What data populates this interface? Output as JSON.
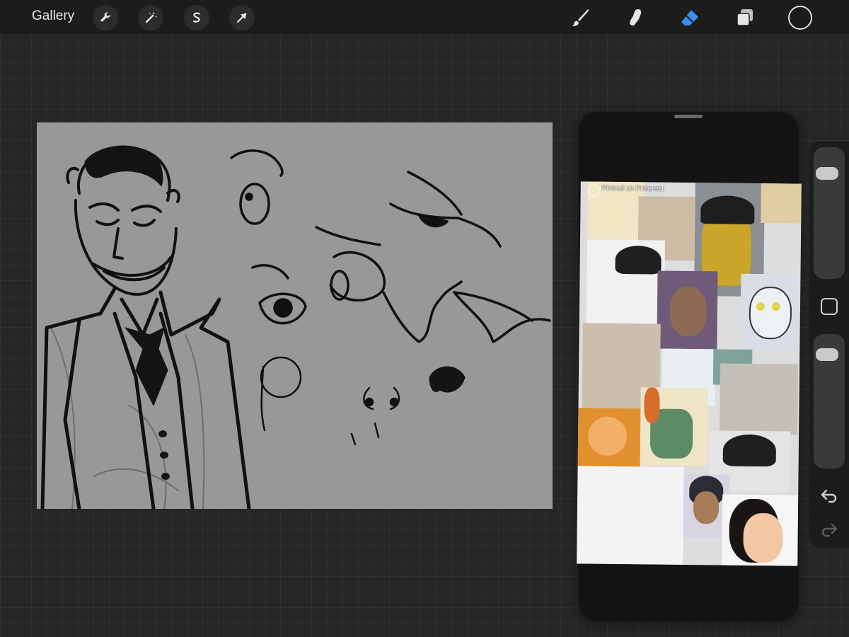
{
  "app": {
    "gallery_label": "Gallery"
  },
  "toolbar": {
    "left_tools": [
      {
        "name": "actions",
        "icon": "wrench-icon"
      },
      {
        "name": "adjustments",
        "icon": "magic-wand-icon"
      },
      {
        "name": "selection",
        "icon": "selection-s-icon"
      },
      {
        "name": "transform",
        "icon": "arrow-cursor-icon"
      }
    ],
    "right_tools": [
      {
        "name": "paint",
        "icon": "brush-icon",
        "active": false
      },
      {
        "name": "smudge",
        "icon": "smudge-finger-icon",
        "active": false
      },
      {
        "name": "erase",
        "icon": "eraser-icon",
        "active": true
      },
      {
        "name": "layers",
        "icon": "layers-icon",
        "active": false
      }
    ],
    "current_color": "#1a1a1a",
    "active_tool_color": "#3a8ef0"
  },
  "reference": {
    "pin_label": "Pinned on Pinterest"
  },
  "sidebar": {
    "brush_size": 0.85,
    "brush_opacity": 0.9,
    "undo_icon": "undo-icon",
    "redo_icon": "redo-icon",
    "modify_icon": "eyedropper-square-icon"
  }
}
